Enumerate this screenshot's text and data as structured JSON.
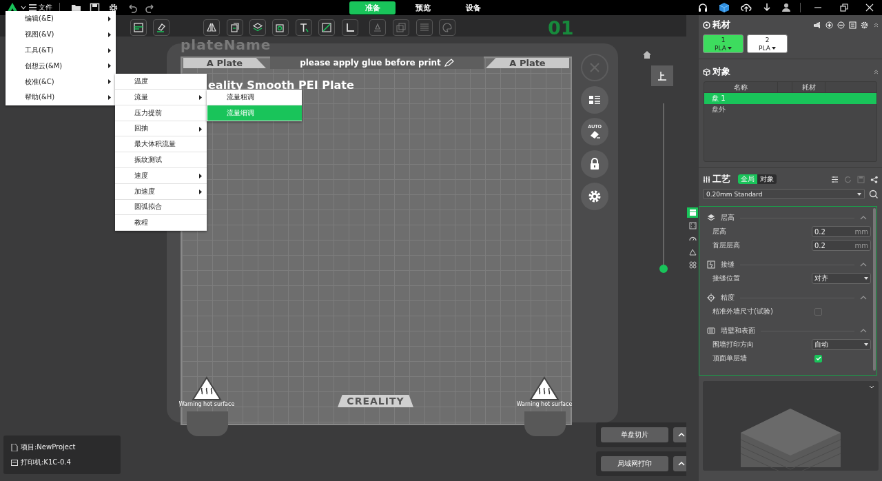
{
  "top_bar": {
    "file_menu": "文件",
    "tabs": [
      {
        "label": "准备",
        "selected": true
      },
      {
        "label": "预览",
        "selected": false
      },
      {
        "label": "设备",
        "selected": false
      }
    ]
  },
  "menu": {
    "items": [
      {
        "label": "编辑(&E)",
        "has_submenu": true
      },
      {
        "label": "视图(&V)",
        "has_submenu": true
      },
      {
        "label": "工具(&T)",
        "has_submenu": true
      },
      {
        "label": "创想云(&M)",
        "has_submenu": true
      },
      {
        "label": "校准(&C)",
        "has_submenu": true,
        "children": [
          {
            "label": "温度",
            "has_submenu": false
          },
          {
            "label": "流量",
            "has_submenu": true,
            "children": [
              {
                "label": "流量粗调",
                "has_submenu": false,
                "selected": false
              },
              {
                "label": "流量细调",
                "has_submenu": false,
                "selected": true
              }
            ]
          },
          {
            "label": "压力提前",
            "has_submenu": false
          },
          {
            "label": "回抽",
            "has_submenu": true
          },
          {
            "label": "最大体积流量",
            "has_submenu": false
          },
          {
            "label": "振纹测试",
            "has_submenu": false
          },
          {
            "label": "速度",
            "has_submenu": true
          },
          {
            "label": "加速度",
            "has_submenu": true
          },
          {
            "label": "圆弧拟合",
            "has_submenu": false
          },
          {
            "label": "教程",
            "has_submenu": false
          }
        ]
      },
      {
        "label": "帮助(&H)",
        "has_submenu": true
      }
    ]
  },
  "viewport": {
    "plate_name": "plateName",
    "plate_number": "01",
    "plate": {
      "label_left": "A Plate",
      "label_right": "A Plate",
      "notice": "please apply glue before print",
      "surface": "eality Smooth PEI Plate",
      "brand": "CREALITY",
      "warnings": [
        "Warning hot surface",
        "Warning hot surface"
      ]
    },
    "auto_label": "AUTO",
    "layer_slider": {
      "level": 0
    },
    "slice_button": "单盘切片",
    "print_button": "局域网打印",
    "project": "项目:NewProject",
    "printer": "打印机:K1C-0.4"
  },
  "sidebar": {
    "filament": {
      "title": "耗材",
      "items": [
        {
          "number": "1",
          "type": "PLA",
          "selected": true
        },
        {
          "number": "2",
          "type": "PLA",
          "selected": false
        }
      ]
    },
    "objects": {
      "title": "对象",
      "columns": [
        "名称",
        "耗材"
      ],
      "rows": [
        {
          "name": "盘 1",
          "selected": true
        },
        {
          "name": "盘外",
          "selected": false
        }
      ]
    },
    "process": {
      "title": "工艺",
      "scope_tabs": [
        {
          "label": "全局",
          "selected": true
        },
        {
          "label": "对象",
          "selected": false
        }
      ],
      "preset": "0.20mm Standard",
      "category_tabs": [
        {
          "selected": true
        },
        {
          "selected": false
        },
        {
          "selected": false
        },
        {
          "selected": false
        },
        {
          "selected": false
        }
      ],
      "sections": [
        {
          "title": "层高",
          "expanded": true,
          "settings": [
            {
              "kind": "number",
              "label": "层高",
              "value": "0.2",
              "unit": "mm"
            },
            {
              "kind": "number",
              "label": "首层层高",
              "value": "0.2",
              "unit": "mm"
            }
          ]
        },
        {
          "title": "接缝",
          "expanded": true,
          "settings": [
            {
              "kind": "select",
              "label": "接缝位置",
              "value": "对齐"
            }
          ]
        },
        {
          "title": "精度",
          "expanded": true,
          "settings": [
            {
              "kind": "checkbox",
              "label": "精准外墙尺寸(试验)",
              "checked": false
            }
          ]
        },
        {
          "title": "墙壁和表面",
          "expanded": true,
          "settings": [
            {
              "kind": "select",
              "label": "围墙打印方向",
              "value": "自动"
            },
            {
              "kind": "checkbox",
              "label": "顶面单层墙",
              "checked": true
            }
          ]
        }
      ]
    }
  }
}
